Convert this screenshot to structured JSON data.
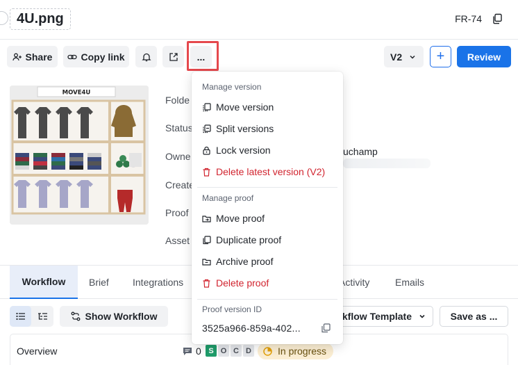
{
  "header": {
    "file_name": "4U.png",
    "id": "FR-74"
  },
  "toolbar": {
    "share_label": "Share",
    "copy_link_label": "Copy link",
    "more_label": "...",
    "version": "V2",
    "add_label": "+",
    "review_label": "Review"
  },
  "thumbnail": {
    "brand": "MOVE4U"
  },
  "meta": {
    "labels": [
      "Folde",
      "Status",
      "Owne",
      "Create",
      "Proof",
      "Asset"
    ],
    "owner_name": "uchamp"
  },
  "tabs": [
    "Workflow",
    "Brief",
    "Integrations",
    "Activity",
    "Emails"
  ],
  "workflow": {
    "show_workflow_label": "Show Workflow",
    "template_label": "Workflow Template",
    "save_as_label": "Save as ..."
  },
  "overview": {
    "label": "Overview",
    "comment_count": "0",
    "stage_badges": [
      "S",
      "O",
      "C",
      "D"
    ],
    "status": "In progress"
  },
  "menu": {
    "manage_version_header": "Manage version",
    "version_items": [
      "Move version",
      "Split versions",
      "Lock version",
      "Delete latest version (V2)"
    ],
    "manage_proof_header": "Manage proof",
    "proof_items": [
      "Move proof",
      "Duplicate proof",
      "Archive proof",
      "Delete proof"
    ],
    "proof_version_header": "Proof version ID",
    "proof_version_id": "3525a966-859a-402..."
  },
  "colors": {
    "accent": "#1a73e8",
    "danger": "#d1242f",
    "highlight": "#e5484d",
    "status_bg": "#fbeed3",
    "badge_green": "#1f9d6b"
  },
  "icons": [
    "share-icon",
    "link-icon",
    "bell-icon",
    "export-icon",
    "copy-icon",
    "chevron-down-icon",
    "list-view-icon",
    "tree-view-icon",
    "workflow-icon",
    "comment-icon",
    "progress-icon",
    "lock-icon",
    "trash-icon",
    "move-icon",
    "archive-icon"
  ]
}
